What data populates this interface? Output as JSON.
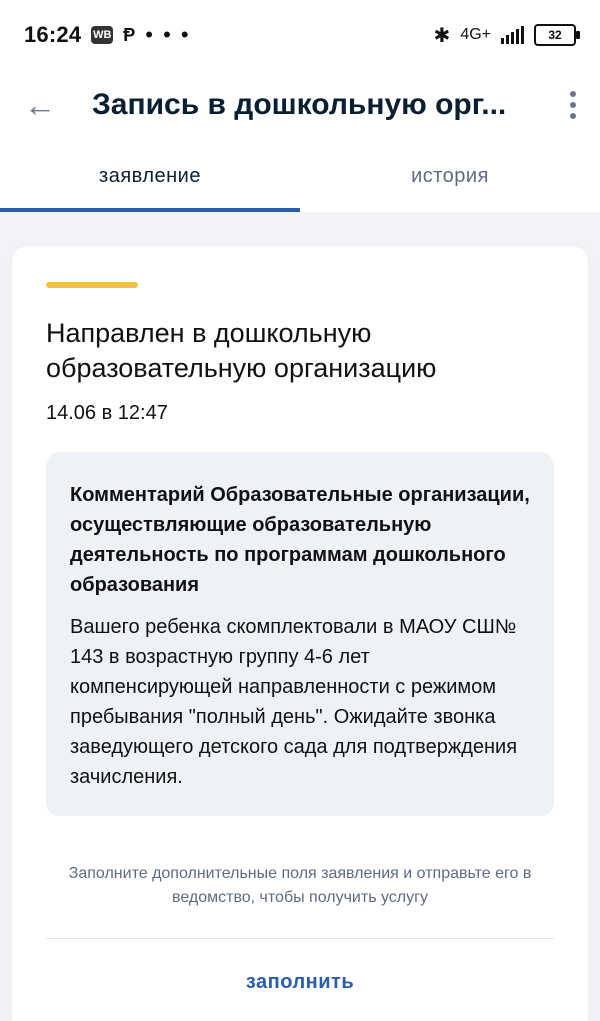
{
  "status_bar": {
    "time": "16:24",
    "badge_wb": "WB",
    "p_glyph": "Ᵽ",
    "dots": "• • •",
    "network": "4G+",
    "battery": "32"
  },
  "app_bar": {
    "title": "Запись в дошкольную орг..."
  },
  "tabs": [
    {
      "label": "заявление",
      "active": true
    },
    {
      "label": "история",
      "active": false
    }
  ],
  "card": {
    "status_title": "Направлен в дошкольную образовательную организацию",
    "date": "14.06 в 12:47",
    "comment_title": "Комментарий Образовательные организации, осуществляющие образовательную деятельность по программам дошкольного образования",
    "comment_text": "Вашего ребенка скомплектовали в МАОУ СШ№ 143 в возрастную группу 4-6 лет компенсирующей направленности с режимом пребывания \"полный день\". Ожидайте звонка заведующего детского сада для подтверждения зачисления.",
    "hint": "Заполните дополнительные поля заявления и отправьте его в ведомство, чтобы получить услугу",
    "fill_label": "заполнить"
  },
  "colors": {
    "accent": "#2a5dab",
    "yellow_bar": "#f0c43a",
    "muted": "#5f6b82",
    "icon_gray": "#6a7691"
  },
  "icons": {
    "back": "arrow-left-icon",
    "more": "more-vertical-icon",
    "bluetooth": "bluetooth-icon",
    "signal": "signal-icon",
    "battery": "battery-icon"
  }
}
